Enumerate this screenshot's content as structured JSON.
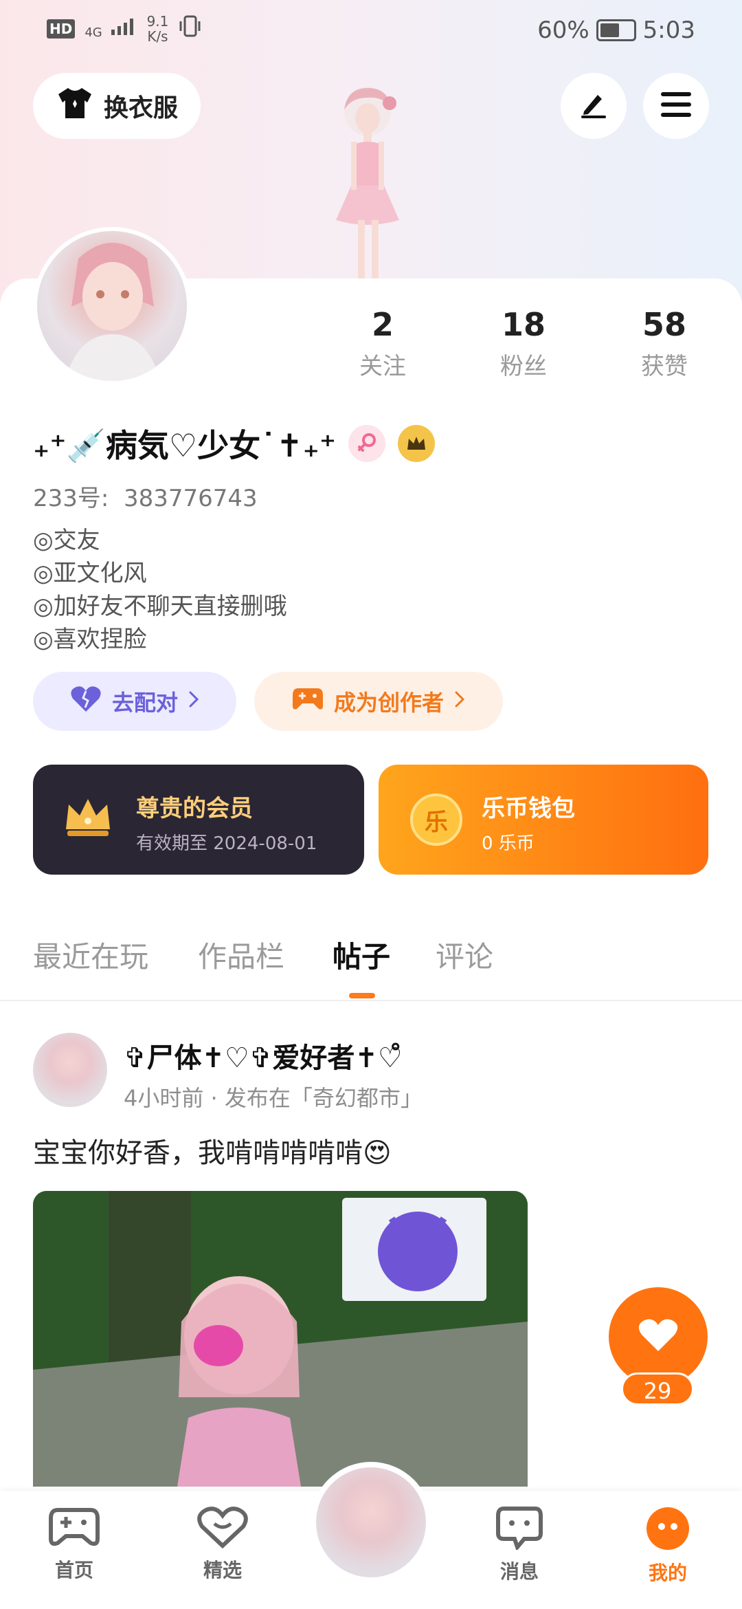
{
  "status_bar": {
    "hd": "HD",
    "network": "4G",
    "speed_value": "9.1",
    "speed_unit": "K/s",
    "battery": "60%",
    "battery_level": 0.6,
    "time": "5:03"
  },
  "header": {
    "outfit_button": "换衣服",
    "edit_icon": "pencil-icon",
    "menu_icon": "hamburger-menu-icon"
  },
  "stats": [
    {
      "value": "2",
      "label": "关注"
    },
    {
      "value": "18",
      "label": "粉丝"
    },
    {
      "value": "58",
      "label": "获赞"
    }
  ],
  "profile": {
    "nickname": "₊⁺💉病気♡少女˙✝︎₊⁺",
    "id_label": "233号:",
    "id_value": "383776743",
    "bio": [
      "◎交友",
      "◎亚文化风",
      "◎加好友不聊天直接删哦",
      "◎喜欢捏脸"
    ]
  },
  "actions": {
    "match": "去配对",
    "creator": "成为创作者"
  },
  "cards": {
    "vip_title": "尊贵的会员",
    "vip_sub": "有效期至 2024-08-01",
    "coin_title": "乐币钱包",
    "coin_sub": "0 乐币",
    "coin_glyph": "乐"
  },
  "tabs": [
    {
      "label": "最近在玩",
      "active": false
    },
    {
      "label": "作品栏",
      "active": false
    },
    {
      "label": "帖子",
      "active": true
    },
    {
      "label": "评论",
      "active": false
    }
  ],
  "post": {
    "author": "✞尸体✝♡✞爱好者✝♡̊",
    "meta": "4小时前 · 发布在「奇幻都市」",
    "text": "宝宝你好香，我啃啃啃啃啃😍"
  },
  "like": {
    "count": "29"
  },
  "bottom_nav": [
    {
      "label": "首页",
      "icon": "gamepad-icon",
      "active": false
    },
    {
      "label": "精选",
      "icon": "heart-badge-icon",
      "active": false
    },
    {
      "label": "消息",
      "icon": "chat-bubble-icon",
      "active": false
    },
    {
      "label": "我的",
      "icon": "profile-face-icon",
      "active": true
    }
  ],
  "colors": {
    "accent": "#ff7411",
    "match_accent": "#6b61d9",
    "vip_bg": "#2a2634",
    "vip_gold": "#ffcf7a"
  }
}
